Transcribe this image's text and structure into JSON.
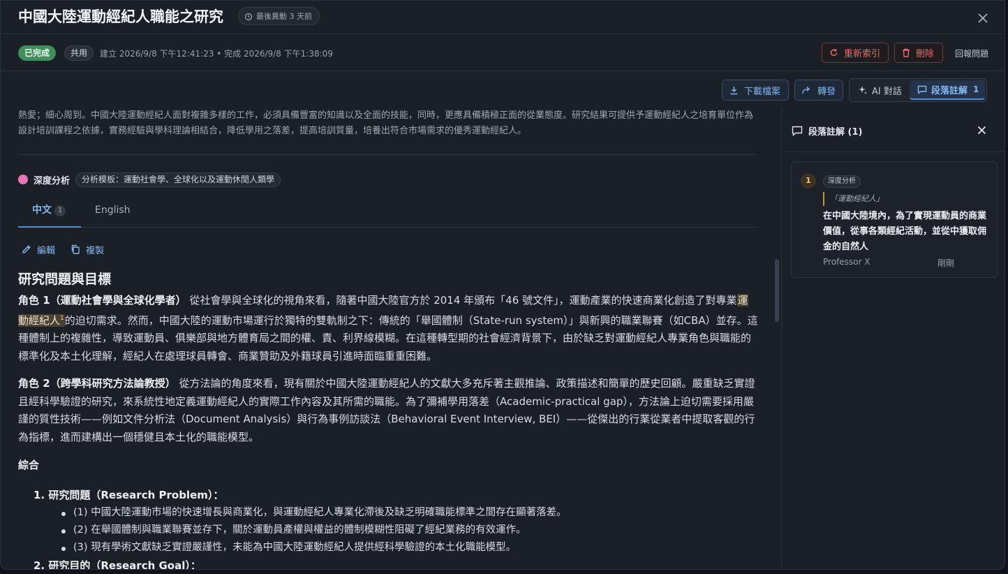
{
  "header": {
    "title": "中國大陸運動經紀人職能之研究",
    "modified": "最後異動 3 天前"
  },
  "meta": {
    "status": "已完成",
    "shared": "共用",
    "timestamps": "建立 2026/9/8 下午12:41:23 • 完成 2026/9/8 下午1:38:09",
    "reindex": "重新索引",
    "delete": "刪除",
    "report": "回報問題"
  },
  "toolbar": {
    "download": "下載檔案",
    "forward": "轉發",
    "ai_chat": "AI 對話",
    "annotations": "段落註解",
    "annotations_count": "1"
  },
  "content": {
    "intro": "熱愛；細心周到。中國大陸運動經紀人面對複雜多樣的工作，必須具備豐富的知識以及全面的技能，同時，更應具備積極正面的從業態度。研究結果可提供予運動經紀人之培育單位作為設計培訓課程之依據，實務經驗與學科理論相結合，降低學用之落差，提高培訓質量，培養出符合市場需求的優秀運動經紀人。",
    "deep_label": "深度分析",
    "template": "分析模板：運動社會學、全球化以及運動休閒人類學",
    "tabs": [
      {
        "label": "中文",
        "count": "1"
      },
      {
        "label": "English"
      }
    ],
    "edit": "編輯",
    "copy": "複製",
    "heading": "研究問題與目標",
    "role1_title": "角色 1（運動社會學與全球化學者）",
    "role1_a": " 從社會學與全球化的視角來看，隨著中國大陸官方於 2014 年頒布「46 號文件」，運動產業的快速商業化創造了對專業",
    "role1_hl": "運動經紀人",
    "role1_hl_num": "1",
    "role1_b": "的迫切需求。然而，中國大陸的運動市場運行於獨特的雙軌制之下：傳統的「舉國體制（State-run system）」與新興的職業聯賽（如CBA）並存。這種體制上的複雜性，導致運動員、俱樂部與地方體育局之間的權、責、利界線模糊。在這種轉型期的社會經濟背景下，由於缺乏對運動經紀人專業角色與職能的標準化及本土化理解，經紀人在處理球員轉會、商業贊助及外籍球員引進時面臨重重困難。",
    "role2_title": "角色 2（跨學科研究方法論教授）",
    "role2_text": " 從方法論的角度來看，現有關於中國大陸運動經紀人的文獻大多充斥著主觀推論、政策描述和簡單的歷史回顧。嚴重缺乏實證且經科學驗證的研究，來系統性地定義運動經紀人的實際工作內容及其所需的職能。為了彌補學用落差（Academic-practical gap），方法論上迫切需要採用嚴謹的質性技術——例如文件分析法（Document Analysis）與行為事例訪談法（Behavioral Event Interview, BEI）——從傑出的行業從業者中提取客觀的行為指標，進而建構出一個穩健且本土化的職能模型。",
    "summary_heading": "綜合",
    "list": [
      {
        "label": "1. 研究問題（Research Problem）：",
        "items": [
          "(1) 中國大陸運動市場的快速增長與商業化，與運動經紀人專業化滯後及缺乏明確職能標準之間存在顯著落差。",
          "(2) 在舉國體制與職業聯賽並存下，關於運動員產權與權益的體制模糊性阻礙了經紀業務的有效運作。",
          "(3) 現有學術文獻缺乏實證嚴謹性，未能為中國大陸運動經紀人提供經科學驗證的本土化職能模型。"
        ]
      },
      {
        "label": "2. 研究目的（Research Goal）：",
        "items": []
      }
    ]
  },
  "side_panel": {
    "title": "段落註解 (1)",
    "note": {
      "num": "1",
      "tag": "深度分析",
      "quote": "「運動經紀人」",
      "body": "在中國大陸境內，為了實現運動員的商業價值，從事各類經紀活動，並從中獲取佣金的自然人",
      "author": "Professor X",
      "time": "剛剛"
    }
  }
}
